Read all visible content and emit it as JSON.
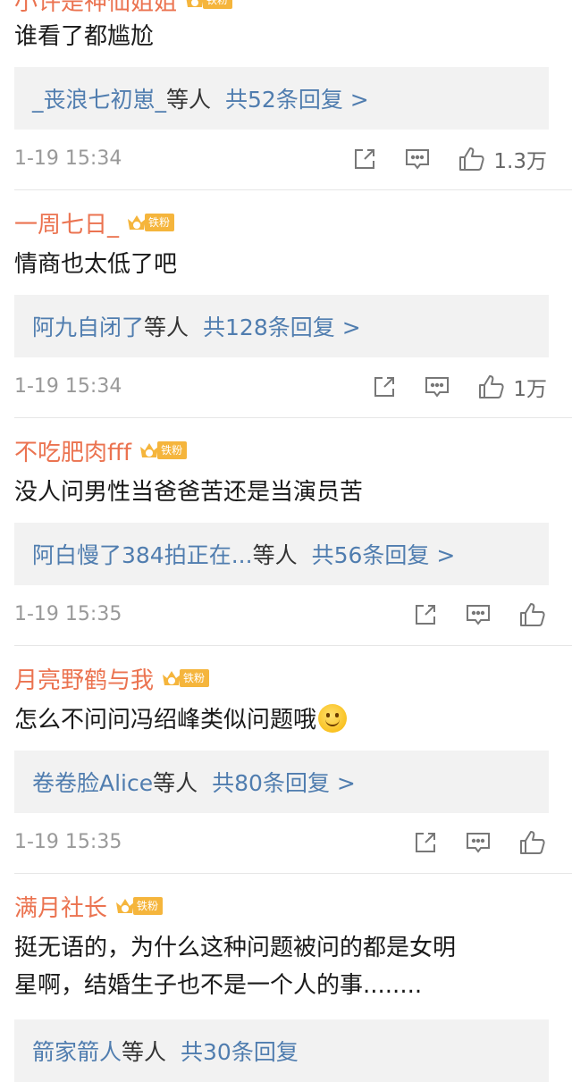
{
  "comments": [
    {
      "username": "小许是神仙姐姐",
      "badge": "铁粉",
      "text": "谁看了都尴尬",
      "reply_names": "_丧浪七初崽_",
      "reply_suffix": "等人",
      "reply_count": "共52条回复 >",
      "time": "1-19 15:34",
      "likes": "1.3万"
    },
    {
      "username": "一周七日_",
      "badge": "铁粉",
      "text": "情商也太低了吧",
      "reply_names": "阿九自闭了",
      "reply_suffix": "等人",
      "reply_count": "共128条回复 >",
      "time": "1-19 15:34",
      "likes": "1万"
    },
    {
      "username": "不吃肥肉fff",
      "badge": "铁粉",
      "text": "没人问男性当爸爸苦还是当演员苦",
      "reply_names": "阿白慢了384拍正在...",
      "reply_suffix": "等人",
      "reply_count": "共56条回复 >",
      "time": "1-19 15:35",
      "likes": ""
    },
    {
      "username": "月亮野鹤与我",
      "badge": "铁粉",
      "text": "怎么不问问冯绍峰类似问题哦",
      "reply_names": "卷卷脸Alice",
      "reply_suffix": "等人",
      "reply_count": "共80条回复 >",
      "time": "1-19 15:35",
      "likes": ""
    },
    {
      "username": "满月社长",
      "badge": "铁粉",
      "text_line1": "挺无语的，为什么这种问题被问的都是女明",
      "text_line2": "星啊，结婚生子也不是一个人的事........",
      "reply_names": "箭家箭人",
      "reply_suffix": "等人",
      "reply_count": "共30条回复"
    }
  ],
  "icons": {
    "repost": "repost-icon",
    "comment": "comment-icon",
    "like": "thumbs-up-icon",
    "badge": "crown-badge-icon",
    "emoji": "smile-emoji-icon"
  },
  "colors": {
    "username": "#eb7350",
    "link": "#507daf",
    "meta": "#999999",
    "badge": "#f5b53c"
  }
}
